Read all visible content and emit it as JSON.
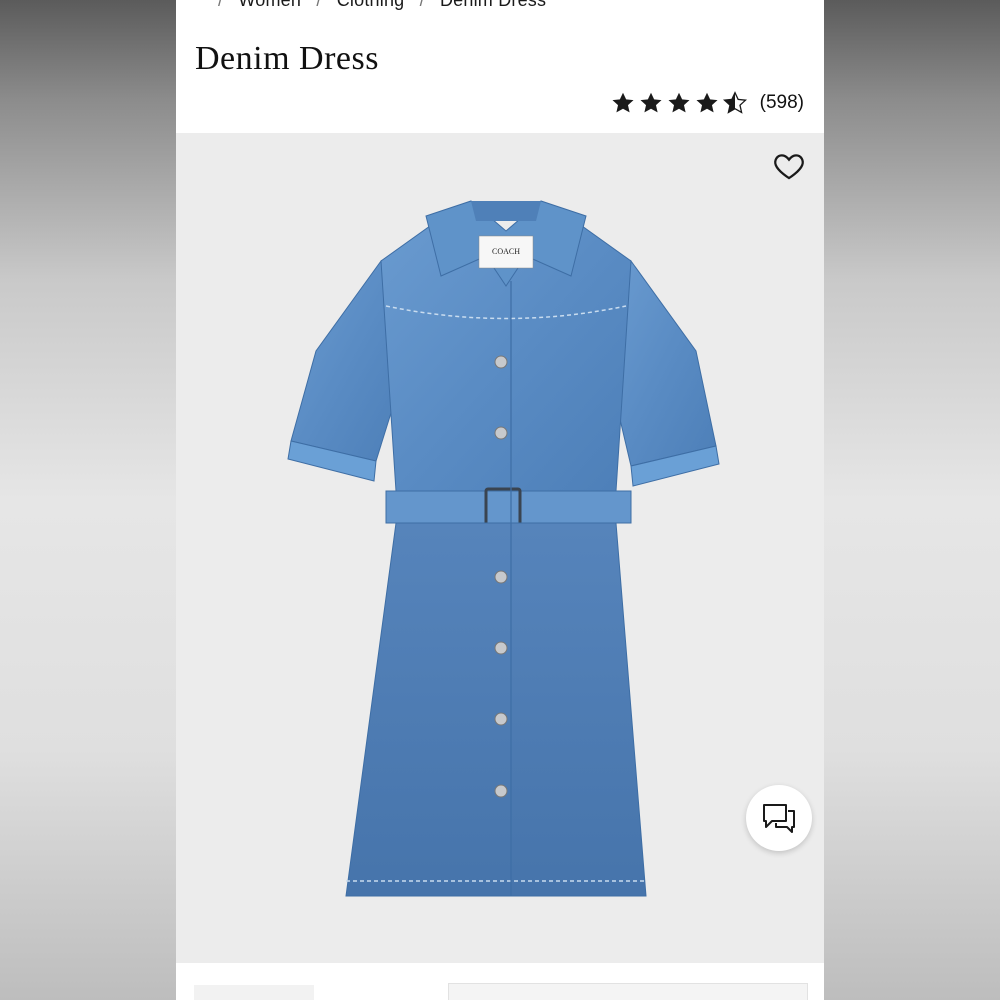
{
  "breadcrumb": {
    "items": [
      "Women",
      "Clothing",
      "Denim Dress"
    ]
  },
  "product": {
    "title": "Denim Dress",
    "rating": 4.5,
    "rating_count_text": "(598)",
    "brand_label": "COACH"
  },
  "icons": {
    "wishlist": "heart-outline-icon",
    "chat": "chat-bubbles-icon",
    "star": "star-icon"
  },
  "colors": {
    "star": "#1a1a1a",
    "denim": "#5b8ec4",
    "background": "#ececec"
  }
}
